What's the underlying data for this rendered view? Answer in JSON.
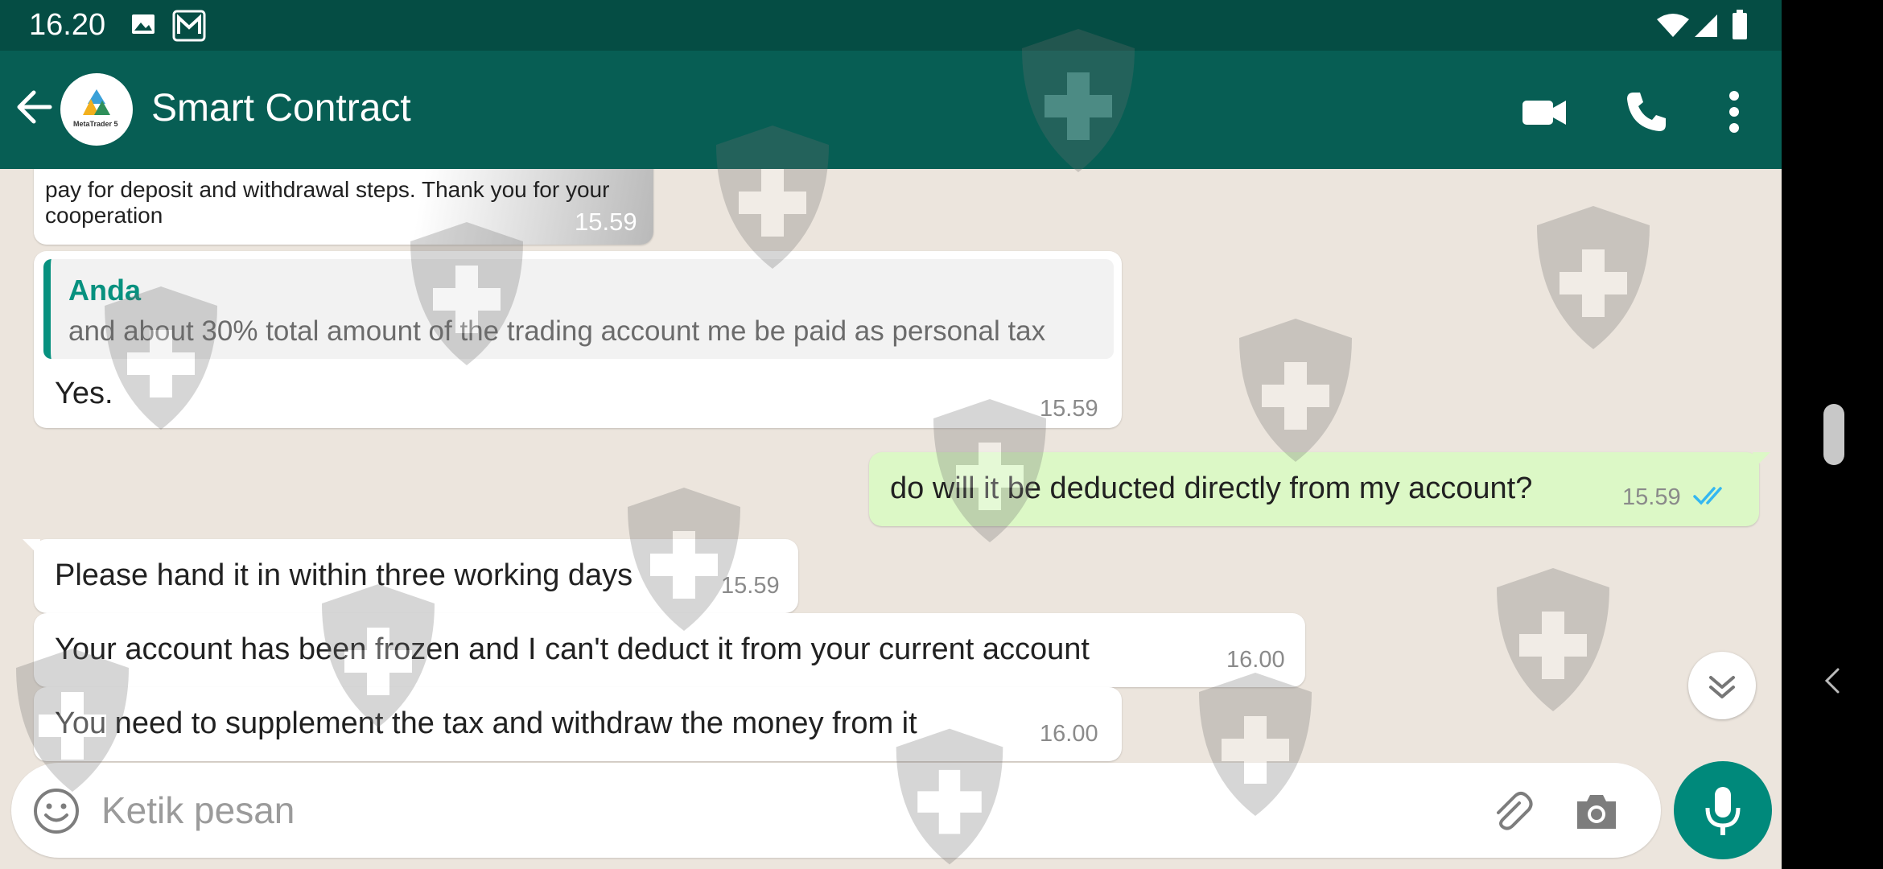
{
  "status_bar": {
    "time": "16.20"
  },
  "header": {
    "title": "Smart Contract",
    "avatar_text": "MetaTrader 5"
  },
  "messages": {
    "m1": {
      "text_line1": "pay for deposit and withdrawal steps. Thank you for your",
      "text_line2": "cooperation",
      "time": "15.59"
    },
    "m2": {
      "quote_sender": "Anda",
      "quote_text": "and about 30% total amount of the trading account me be paid as personal tax",
      "text": "Yes.",
      "time": "15.59"
    },
    "m3": {
      "text": "do will it be deducted directly from my account?",
      "time": "15.59"
    },
    "m4": {
      "text": "Please hand it in within three working days",
      "time": "15.59"
    },
    "m5": {
      "text": "Your account has been frozen and I can't deduct it from your current account",
      "time": "16.00"
    },
    "m6": {
      "text": "You need to supplement the tax and withdraw the money from it",
      "time": "16.00"
    }
  },
  "composer": {
    "placeholder": "Ketik pesan"
  },
  "colors": {
    "header": "#075e54",
    "status_bar": "#054d44",
    "outgoing_bubble": "#dcf8c6",
    "accent": "#00897b",
    "read_ticks": "#34b7f1"
  }
}
